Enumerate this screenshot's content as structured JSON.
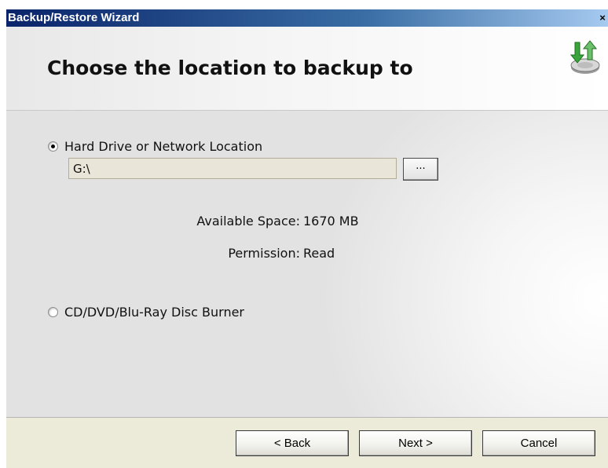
{
  "window": {
    "title": "Backup/Restore Wizard",
    "close_glyph": "×"
  },
  "header": {
    "heading": "Choose the location to backup to",
    "icon": "backup-drive-arrows-icon"
  },
  "options": {
    "hard_drive": {
      "label": "Hard Drive or Network Location",
      "selected": true,
      "path_value": "G:\\",
      "browse_label": "...",
      "available_space_label": "Available Space:",
      "available_space_value": "1670 MB",
      "permission_label": "Permission:",
      "permission_value": "Read"
    },
    "disc_burner": {
      "label": "CD/DVD/Blu-Ray Disc Burner",
      "selected": false
    }
  },
  "buttons": {
    "back": "< Back",
    "next": "Next >",
    "cancel": "Cancel"
  },
  "colors": {
    "titlebar_start": "#0a246a",
    "titlebar_end": "#a6caf0",
    "input_bg": "#e9e5d8",
    "footer_bg": "#ecead8",
    "icon_green": "#3aa53a"
  }
}
